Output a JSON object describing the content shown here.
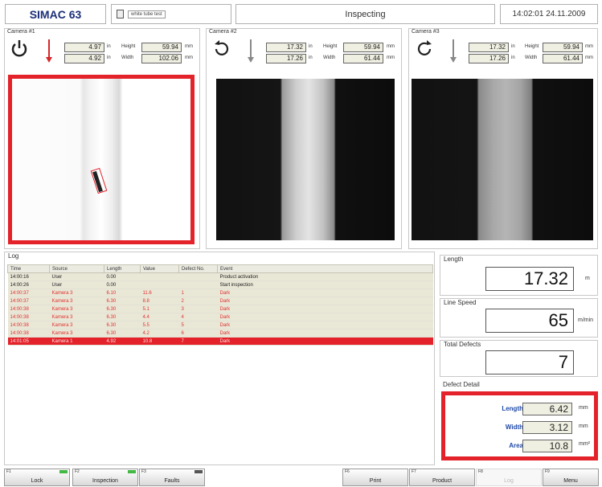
{
  "header": {
    "brand": "SIMAC 63",
    "product_type": "white tube test",
    "status": "Inspecting",
    "datetime": "14:02:01  24.11.2009"
  },
  "cameras": [
    {
      "title": "Camera #1",
      "icon": "power-icon",
      "arrow_color": "#d4282a",
      "top_value": "4.97",
      "bottom_value": "4.92",
      "in_unit": "in",
      "height_label": "Height",
      "height_value": "59.94",
      "width_label": "Width",
      "width_value": "102.06",
      "mm_unit": "mm"
    },
    {
      "title": "Camera #2",
      "icon": "rotate-ccw-icon",
      "arrow_color": "#888888",
      "top_value": "17.32",
      "bottom_value": "17.26",
      "in_unit": "in",
      "height_label": "Height",
      "height_value": "59.94",
      "width_label": "Width",
      "width_value": "61.44",
      "mm_unit": "mm"
    },
    {
      "title": "Camera #3",
      "icon": "rotate-cw-icon",
      "arrow_color": "#888888",
      "top_value": "17.32",
      "bottom_value": "17.26",
      "in_unit": "in",
      "height_label": "Height",
      "height_value": "59.94",
      "width_label": "Width",
      "width_value": "61.44",
      "mm_unit": "mm"
    }
  ],
  "log": {
    "title": "Log",
    "columns": [
      "Time",
      "Source",
      "Length",
      "Value",
      "Defect No.",
      "Event"
    ],
    "rows": [
      {
        "time": "14:00:16",
        "source": "User",
        "length": "0.00",
        "value": "",
        "defect": "",
        "event": "Product activation",
        "state": "normal"
      },
      {
        "time": "14:00:26",
        "source": "User",
        "length": "0.00",
        "value": "",
        "defect": "",
        "event": "Start inspection",
        "state": "normal"
      },
      {
        "time": "14:00:37",
        "source": "Kamera 3",
        "length": "6.10",
        "value": "11.6",
        "defect": "1",
        "event": "Dark",
        "state": "alarm"
      },
      {
        "time": "14:00:37",
        "source": "Kamera 3",
        "length": "6.30",
        "value": "8.8",
        "defect": "2",
        "event": "Dark",
        "state": "alarm"
      },
      {
        "time": "14:00:38",
        "source": "Kamera 3",
        "length": "6.30",
        "value": "5.1",
        "defect": "3",
        "event": "Dark",
        "state": "alarm"
      },
      {
        "time": "14:00:38",
        "source": "Kamera 3",
        "length": "6.30",
        "value": "4.4",
        "defect": "4",
        "event": "Dark",
        "state": "alarm"
      },
      {
        "time": "14:00:38",
        "source": "Kamera 3",
        "length": "6.30",
        "value": "5.5",
        "defect": "5",
        "event": "Dark",
        "state": "alarm"
      },
      {
        "time": "14:00:38",
        "source": "Kamera 3",
        "length": "6.30",
        "value": "4.2",
        "defect": "6",
        "event": "Dark",
        "state": "alarm"
      },
      {
        "time": "14:01:05",
        "source": "Kamera 1",
        "length": "4.92",
        "value": "10.8",
        "defect": "7",
        "event": "Dark",
        "state": "selected"
      }
    ]
  },
  "length_panel": {
    "title": "Length",
    "value": "17.32",
    "unit": "m"
  },
  "speed_panel": {
    "title": "Line Speed",
    "value": "65",
    "unit": "m/min"
  },
  "defects_panel": {
    "title": "Total Defects",
    "value": "7"
  },
  "defect_detail": {
    "title": "Defect Detail",
    "length_label": "Length",
    "length_value": "6.42",
    "length_unit": "mm",
    "width_label": "Width",
    "width_value": "3.12",
    "width_unit": "mm",
    "area_label": "Area",
    "area_value": "10.8",
    "area_unit": "mm²"
  },
  "fkeys": [
    {
      "num": "F1",
      "label": "Lock",
      "led": "#44b844",
      "enabled": true
    },
    {
      "num": "F2",
      "label": "Inspection",
      "led": "#44b844",
      "enabled": true
    },
    {
      "num": "F3",
      "label": "Faults",
      "led": "#555555",
      "enabled": true
    },
    {
      "num": "F6",
      "label": "Print",
      "led": "",
      "enabled": true
    },
    {
      "num": "F7",
      "label": "Product",
      "led": "",
      "enabled": true
    },
    {
      "num": "F8",
      "label": "Log",
      "led": "",
      "enabled": false
    },
    {
      "num": "F9",
      "label": "Menu",
      "led": "",
      "enabled": true
    }
  ],
  "colors": {
    "alarm": "#e3222a",
    "brand": "#1b2f78",
    "label_blue": "#1f4aa8"
  }
}
